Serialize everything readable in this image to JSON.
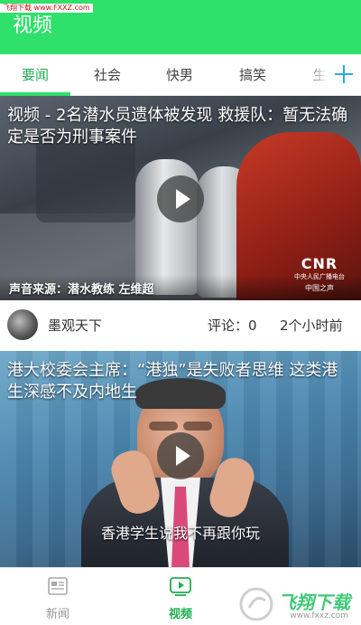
{
  "watermark": "飞翔下载 www.FXXZ.com",
  "header": {
    "title": "视频"
  },
  "tabs": [
    {
      "label": "要闻",
      "active": true
    },
    {
      "label": "社会",
      "active": false
    },
    {
      "label": "快男",
      "active": false
    },
    {
      "label": "搞笑",
      "active": false
    },
    {
      "label": "生",
      "active": false
    }
  ],
  "add_tab_icon": "plus-icon",
  "videos": [
    {
      "title": "视频 - 2名潜水员遗体被发现 救援队：暂无法确定是否为刑事案件",
      "caption": "声音来源：潜水教练 左维超",
      "logo": {
        "name": "CNR",
        "line1": "中央人民广播电台",
        "line2": "中国之声"
      },
      "author": "墨观天下",
      "comments": "评论：0",
      "time": "2个小时前"
    },
    {
      "title": "港大校委会主席：“港独”是失败者思维 这类港生深感不及内地生",
      "caption": "香港学生说我不再跟你玩"
    }
  ],
  "bottom_nav": [
    {
      "label": "新闻",
      "icon": "newspaper-icon",
      "active": false
    },
    {
      "label": "视频",
      "icon": "video-icon",
      "active": true
    }
  ],
  "corner_watermark": {
    "text": "飞翔下载",
    "url": "www.fxxz.com"
  },
  "colors": {
    "accent": "#2fe06a",
    "active_text": "#1fae50"
  }
}
